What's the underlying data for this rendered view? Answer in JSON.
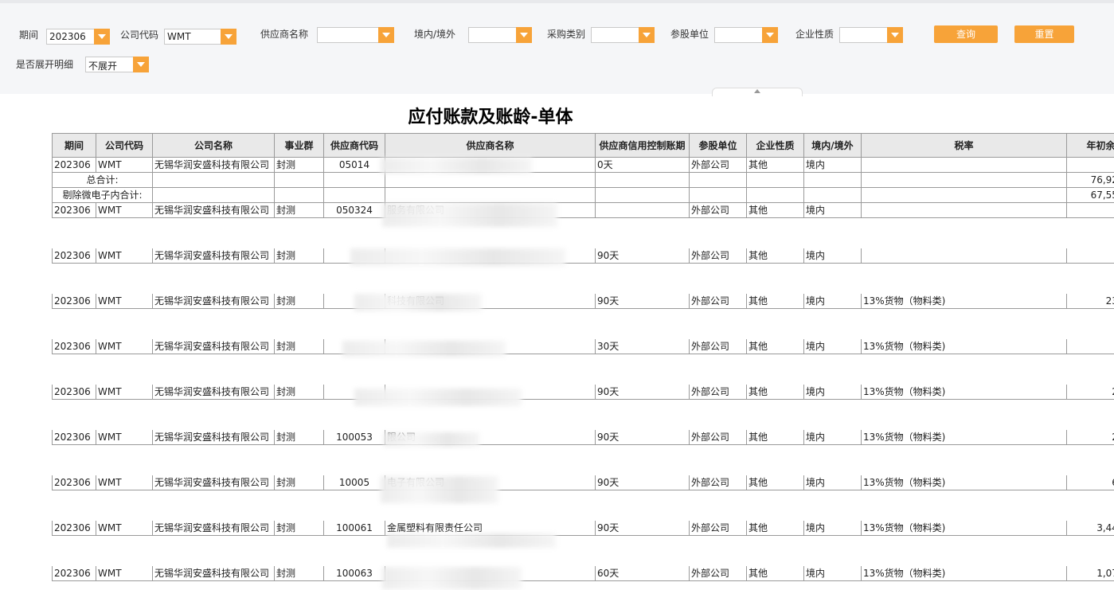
{
  "filters": {
    "period": {
      "label": "期间",
      "value": "202306"
    },
    "company_code": {
      "label": "公司代码",
      "value": "WMT"
    },
    "supplier_name": {
      "label": "供应商名称",
      "value": ""
    },
    "domestic_foreign": {
      "label": "境内/境外",
      "value": ""
    },
    "purchase_category": {
      "label": "采购类别",
      "value": ""
    },
    "share_unit": {
      "label": "参股单位",
      "value": ""
    },
    "enterprise_nature": {
      "label": "企业性质",
      "value": ""
    },
    "expand_detail": {
      "label": "是否展开明细",
      "value": "不展开"
    },
    "query_button": "查询",
    "reset_button": "重置"
  },
  "report": {
    "title": "应付账款及账龄-单体",
    "columns": [
      "期间",
      "公司代码",
      "公司名称",
      "事业群",
      "供应商代码",
      "供应商名称",
      "供应商信用控制账期",
      "参股单位",
      "企业性质",
      "境内/境外",
      "税率",
      "年初余"
    ],
    "rows": [
      {
        "period": "202306",
        "company_code": "WMT",
        "company_name": "无锡华润安盛科技有限公司",
        "group": "封测",
        "supplier_code": "05014",
        "supplier_name": "",
        "credit_term": "0天",
        "share_unit": "外部公司",
        "nature": "其他",
        "domestic": "境内",
        "tax_rate": "",
        "opening": ""
      },
      {
        "period": "",
        "company_code": "",
        "company_name": "",
        "group": "",
        "supplier_code": "",
        "supplier_name": "",
        "credit_term": "",
        "share_unit": "",
        "nature": "",
        "domestic": "",
        "tax_rate": "",
        "opening": "76,921,8",
        "label": "总合计:"
      },
      {
        "period": "",
        "company_code": "",
        "company_name": "",
        "group": "",
        "supplier_code": "",
        "supplier_name": "",
        "credit_term": "",
        "share_unit": "",
        "nature": "",
        "domestic": "",
        "tax_rate": "",
        "opening": "67,556,2",
        "label": "剔除微电子内合计:"
      },
      {
        "period": "202306",
        "company_code": "WMT",
        "company_name": "无锡华润安盛科技有限公司",
        "group": "封测",
        "supplier_code": "050324",
        "supplier_name": "服务有限公司",
        "credit_term": "",
        "share_unit": "外部公司",
        "nature": "其他",
        "domestic": "境内",
        "tax_rate": "",
        "opening": ""
      },
      {
        "period": "202306",
        "company_code": "WMT",
        "company_name": "无锡华润安盛科技有限公司",
        "group": "封测",
        "supplier_code": "",
        "supplier_name": "",
        "credit_term": "90天",
        "share_unit": "外部公司",
        "nature": "其他",
        "domestic": "境内",
        "tax_rate": "",
        "opening": ""
      },
      {
        "period": "202306",
        "company_code": "WMT",
        "company_name": "无锡华润安盛科技有限公司",
        "group": "封测",
        "supplier_code": "",
        "supplier_name": "科技有限公司",
        "credit_term": "90天",
        "share_unit": "外部公司",
        "nature": "其他",
        "domestic": "境内",
        "tax_rate": "13%货物（物料类)",
        "opening": "234,6"
      },
      {
        "period": "202306",
        "company_code": "WMT",
        "company_name": "无锡华润安盛科技有限公司",
        "group": "封测",
        "supplier_code": "",
        "supplier_name": "",
        "credit_term": "30天",
        "share_unit": "外部公司",
        "nature": "其他",
        "domestic": "境内",
        "tax_rate": "13%货物（物料类)",
        "opening": ""
      },
      {
        "period": "202306",
        "company_code": "WMT",
        "company_name": "无锡华润安盛科技有限公司",
        "group": "封测",
        "supplier_code": "",
        "supplier_name": "",
        "credit_term": "90天",
        "share_unit": "外部公司",
        "nature": "其他",
        "domestic": "境内",
        "tax_rate": "13%货物（物料类)",
        "opening": "24,6"
      },
      {
        "period": "202306",
        "company_code": "WMT",
        "company_name": "无锡华润安盛科技有限公司",
        "group": "封测",
        "supplier_code": "100053",
        "supplier_name": "限公司",
        "credit_term": "90天",
        "share_unit": "外部公司",
        "nature": "其他",
        "domestic": "境内",
        "tax_rate": "13%货物（物料类)",
        "opening": "24,7"
      },
      {
        "period": "202306",
        "company_code": "WMT",
        "company_name": "无锡华润安盛科技有限公司",
        "group": "封测",
        "supplier_code": "10005",
        "supplier_name": "电子有限公司",
        "credit_term": "90天",
        "share_unit": "外部公司",
        "nature": "其他",
        "domestic": "境内",
        "tax_rate": "13%货物（物料类)",
        "opening": "68,4"
      },
      {
        "period": "202306",
        "company_code": "WMT",
        "company_name": "无锡华润安盛科技有限公司",
        "group": "封测",
        "supplier_code": "100061",
        "supplier_name": "金属塑料有限责任公司",
        "credit_term": "90天",
        "share_unit": "外部公司",
        "nature": "其他",
        "domestic": "境内",
        "tax_rate": "13%货物（物料类)",
        "opening": "3,448,4"
      },
      {
        "period": "202306",
        "company_code": "WMT",
        "company_name": "无锡华润安盛科技有限公司",
        "group": "封测",
        "supplier_code": "100063",
        "supplier_name": "",
        "credit_term": "60天",
        "share_unit": "外部公司",
        "nature": "其他",
        "domestic": "境内",
        "tax_rate": "13%货物（物料类)",
        "opening": "1,076,9"
      }
    ]
  }
}
